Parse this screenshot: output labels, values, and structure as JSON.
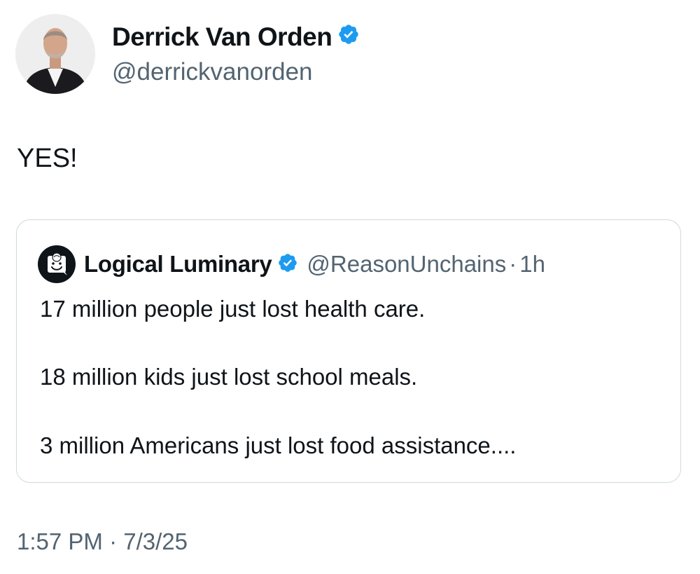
{
  "author": {
    "display_name": "Derrick Van Orden",
    "handle": "@derrickvanorden",
    "verified_icon": "verified-badge-icon",
    "avatar_icon": "profile-photo"
  },
  "tweet": {
    "text": "YES!",
    "time": "1:57 PM",
    "separator": "·",
    "date": "7/3/25"
  },
  "quoted_tweet": {
    "display_name": "Logical Luminary",
    "handle": "@ReasonUnchains",
    "separator": "·",
    "time_ago": "1h",
    "lines": [
      "17 million people just lost health care.",
      "18 million kids just lost school meals.",
      "3 million Americans just lost food assistance...."
    ]
  },
  "colors": {
    "verified_blue": "#1d9bf0",
    "secondary_text": "#536471",
    "border": "#cfd9de",
    "primary_text": "#0f1419"
  }
}
